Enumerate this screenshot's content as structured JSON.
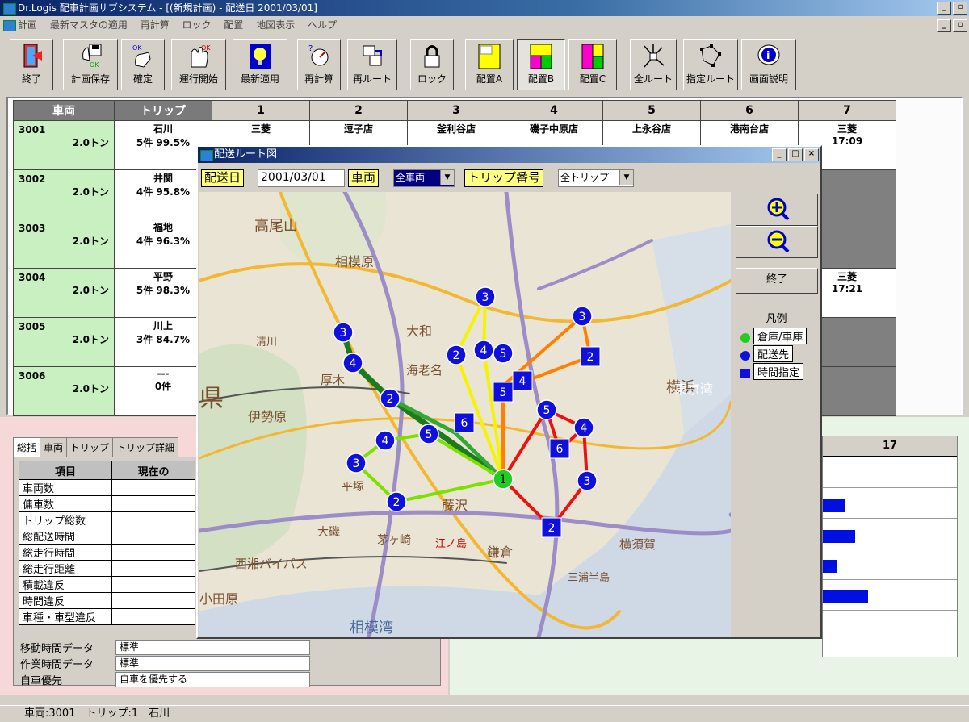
{
  "window": {
    "title": "Dr.Logis 配車計画サブシステム - [(新規計画) - 配送日 2001/03/01]"
  },
  "menu": [
    "計画",
    "最新マスタの適用",
    "再計算",
    "ロック",
    "配置",
    "地図表示",
    "ヘルプ"
  ],
  "toolbar": [
    {
      "label": "終了",
      "icon": "exit-door-icon"
    },
    {
      "label": "計画保存",
      "icon": "save-plan-icon"
    },
    {
      "label": "確定",
      "icon": "confirm-hand-icon"
    },
    {
      "label": "運行開始",
      "icon": "start-operation-icon"
    },
    {
      "label": "最新適用",
      "icon": "lightbulb-icon"
    },
    {
      "label": "再計算",
      "icon": "recalc-icon"
    },
    {
      "label": "再ルート",
      "icon": "reroute-icon"
    },
    {
      "label": "ロック",
      "icon": "lock-icon"
    },
    {
      "label": "配置A",
      "icon": "layout-a-icon"
    },
    {
      "label": "配置B",
      "icon": "layout-b-icon"
    },
    {
      "label": "配置C",
      "icon": "layout-c-icon"
    },
    {
      "label": "全ルート",
      "icon": "all-routes-icon"
    },
    {
      "label": "指定ルート",
      "icon": "selected-route-icon"
    },
    {
      "label": "画面説明",
      "icon": "info-icon"
    }
  ],
  "grid": {
    "headers": [
      "車両",
      "トリップ",
      "1",
      "2",
      "3",
      "4",
      "5",
      "6",
      "7"
    ],
    "rows": [
      {
        "vehicle": "3001",
        "capacity": "2.0トン",
        "trip_name": "石川",
        "trip_info": "5件 99.5%"
      },
      {
        "vehicle": "3002",
        "capacity": "2.0トン",
        "trip_name": "井関",
        "trip_info": "4件 95.8%"
      },
      {
        "vehicle": "3003",
        "capacity": "2.0トン",
        "trip_name": "福地",
        "trip_info": "4件 96.3%"
      },
      {
        "vehicle": "3004",
        "capacity": "2.0トン",
        "trip_name": "平野",
        "trip_info": "5件 98.3%"
      },
      {
        "vehicle": "3005",
        "capacity": "2.0トン",
        "trip_name": "川上",
        "trip_info": "3件 84.7%"
      },
      {
        "vehicle": "3006",
        "capacity": "2.0トン",
        "trip_name": "---",
        "trip_info": "0件"
      }
    ],
    "row1_stops": [
      "三菱",
      "逗子店",
      "釜利谷店",
      "磯子中原店",
      "上永谷店",
      "港南台店"
    ],
    "row1_last": {
      "name": "三菱",
      "time": "17:09"
    },
    "row4_last": {
      "name": "三菱",
      "time": "17:21"
    }
  },
  "bottom": {
    "tabs": [
      "総括",
      "車両",
      "トリップ",
      "トリップ詳細"
    ],
    "table_headers": [
      "項目",
      "現在の"
    ],
    "items": [
      "車両数",
      "傭車数",
      "トリップ総数",
      "総配送時間",
      "総走行時間",
      "総走行距離",
      "積載違反",
      "時間違反",
      "車種・車型違反"
    ],
    "settings": [
      {
        "label": "移動時間データ",
        "value": "標準"
      },
      {
        "label": "作業時間データ",
        "value": "標準"
      },
      {
        "label": "自車優先",
        "value": "自車を優先する"
      }
    ],
    "right_header": "17"
  },
  "status": "車両:3001　トリップ:1　石川",
  "popup": {
    "title": "配送ルート図",
    "date_label": "配送日",
    "date_value": "2001/03/01",
    "vehicle_label": "車両",
    "vehicle_value": "全車両",
    "trip_label": "トリップ番号",
    "trip_value": "全トリップ",
    "close_label": "終了",
    "legend_title": "凡例",
    "legend": [
      {
        "label": "倉庫/車庫",
        "color": "#22cc22",
        "shape": "circle"
      },
      {
        "label": "配送先",
        "color": "#1010dd",
        "shape": "circle"
      },
      {
        "label": "時間指定",
        "color": "#1010dd",
        "shape": "square"
      }
    ],
    "map_labels": [
      "高尾山",
      "相模原",
      "大和",
      "横浜",
      "東京湾",
      "横須賀",
      "鎌倉",
      "藤沢",
      "江ノ島",
      "厚木",
      "海老名",
      "伊勢原",
      "平塚",
      "小田原",
      "西湘バイパス",
      "相模湾",
      "大磯",
      "茅ヶ崎",
      "三浦半島",
      "県",
      "清川"
    ],
    "routes": {
      "green_dark": "#1f7a1f",
      "light_green": "#7ce000",
      "yellow": "#f4f400",
      "orange": "#ff8000",
      "red": "#ee1111"
    },
    "markers": [
      "1",
      "2",
      "3",
      "4",
      "5",
      "6"
    ]
  }
}
